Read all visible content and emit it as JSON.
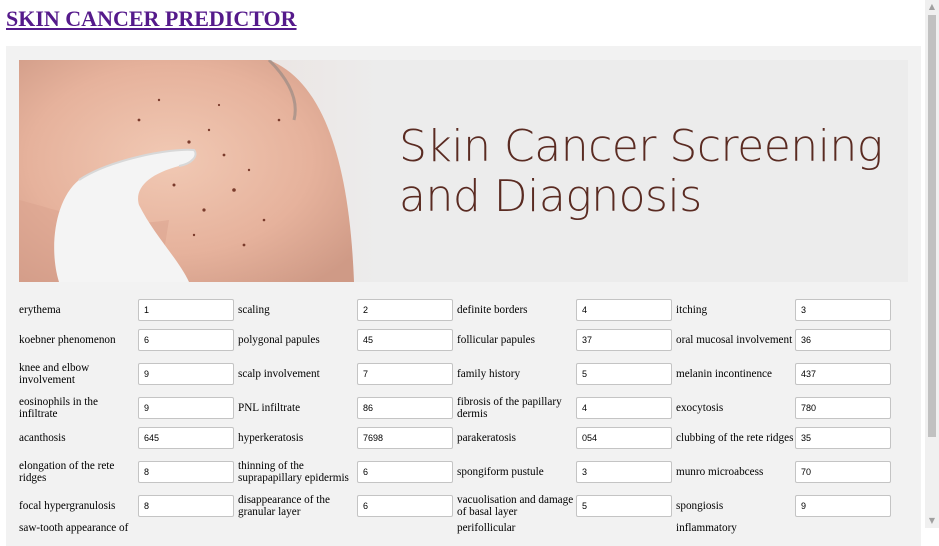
{
  "page": {
    "title": "SKIN CANCER PREDICTOR"
  },
  "banner": {
    "heading_line1": "Skin Cancer Screening",
    "heading_line2": "and Diagnosis"
  },
  "fields": [
    {
      "label": "erythema",
      "value": "1"
    },
    {
      "label": "scaling",
      "value": "2"
    },
    {
      "label": "definite borders",
      "value": "4"
    },
    {
      "label": "itching",
      "value": "3"
    },
    {
      "label": "koebner phenomenon",
      "value": "6"
    },
    {
      "label": "polygonal papules",
      "value": "45"
    },
    {
      "label": "follicular papules",
      "value": "37"
    },
    {
      "label": "oral mucosal involvement",
      "value": "36"
    },
    {
      "label": "knee and elbow involvement",
      "value": "9"
    },
    {
      "label": "scalp involvement",
      "value": "7"
    },
    {
      "label": "family history",
      "value": "5"
    },
    {
      "label": "melanin incontinence",
      "value": "437"
    },
    {
      "label": "eosinophils in the infiltrate",
      "value": "9"
    },
    {
      "label": "PNL infiltrate",
      "value": "86"
    },
    {
      "label": "fibrosis of the papillary dermis",
      "value": "4"
    },
    {
      "label": "exocytosis",
      "value": "780"
    },
    {
      "label": "acanthosis",
      "value": "645"
    },
    {
      "label": "hyperkeratosis",
      "value": "7698"
    },
    {
      "label": "parakeratosis",
      "value": "054"
    },
    {
      "label": "clubbing of the rete ridges",
      "value": "35"
    },
    {
      "label": "elongation of the rete ridges",
      "value": "8"
    },
    {
      "label": "thinning of the suprapapillary epidermis",
      "value": "6"
    },
    {
      "label": "spongiform pustule",
      "value": "3"
    },
    {
      "label": "munro microabcess",
      "value": "70"
    },
    {
      "label": "focal hypergranulosis",
      "value": "8"
    },
    {
      "label": "disappearance of the granular layer",
      "value": "6"
    },
    {
      "label": "vacuolisation and damage of basal layer",
      "value": "5"
    },
    {
      "label": "spongiosis",
      "value": "9"
    }
  ],
  "partial_labels": [
    "saw-tooth appearance of",
    "perifollicular",
    "inflammatory"
  ]
}
